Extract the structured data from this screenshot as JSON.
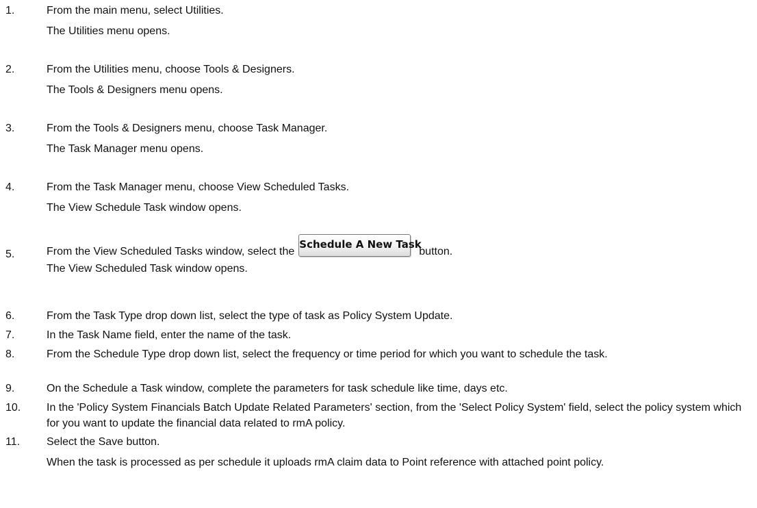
{
  "steps": [
    {
      "number": "1.",
      "text": "From the main menu, select Utilities.",
      "result": "The Utilities menu opens."
    },
    {
      "number": "2.",
      "text": "From the Utilities menu, choose Tools & Designers.",
      "result": "The Tools & Designers menu opens."
    },
    {
      "number": "3.",
      "text": "From the Tools & Designers menu, choose Task Manager.",
      "result": "The Task Manager menu opens."
    },
    {
      "number": "4.",
      "text": "From the Task Manager menu, choose View Scheduled Tasks.",
      "result": "The View Schedule Task window opens."
    },
    {
      "number": "5.",
      "text_before": "From the View Scheduled Tasks window, select the",
      "button_label": "Schedule A New Task",
      "text_after": "button.",
      "result": "The View Scheduled Task window opens."
    },
    {
      "number": "6.",
      "text": "From the Task Type drop down list, select the type of task as Policy System Update."
    },
    {
      "number": "7.",
      "text": "In the Task Name field, enter the name of the task."
    },
    {
      "number": "8.",
      "text": "From the Schedule Type drop down list, select the frequency or time period for which you want to schedule the task."
    },
    {
      "number": "9.",
      "text": "On the Schedule a Task window, complete the parameters for task schedule like time, days etc."
    },
    {
      "number": "10.",
      "text": "In the 'Policy System Financials Batch Update Related Parameters' section, from the 'Select Policy System' field, select the policy system which for  you want to update the financial data related to rmA policy."
    },
    {
      "number": "11.",
      "text": "Select the Save button.",
      "result": "When the task is processed as per schedule it  uploads rmA claim data to Point reference with attached point policy."
    }
  ]
}
